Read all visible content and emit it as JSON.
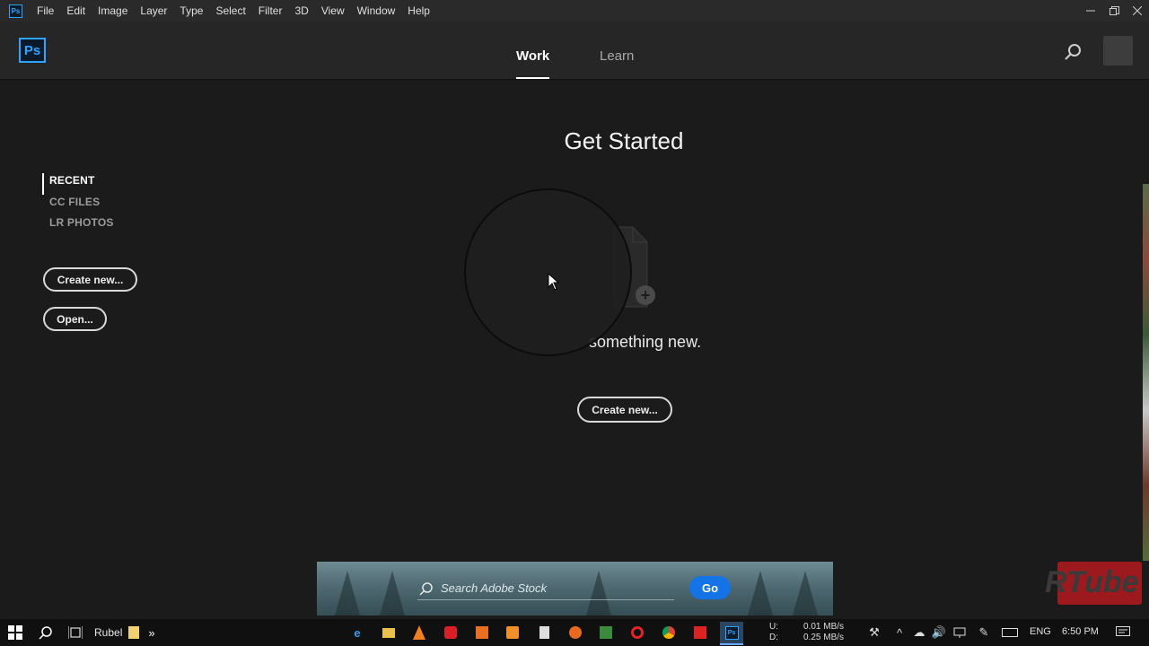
{
  "menubar": {
    "app_icon": "ps-mini-icon",
    "items": [
      "File",
      "Edit",
      "Image",
      "Layer",
      "Type",
      "Select",
      "Filter",
      "3D",
      "View",
      "Window",
      "Help"
    ],
    "controls": {
      "minimize": "minimize-icon",
      "restore": "restore-icon",
      "close": "close-icon"
    }
  },
  "header": {
    "logo": "Ps",
    "tabs": [
      {
        "label": "Work",
        "active": true
      },
      {
        "label": "Learn",
        "active": false
      }
    ]
  },
  "sidebar": {
    "items": [
      {
        "label": "RECENT",
        "active": true
      },
      {
        "label": "CC FILES",
        "active": false
      },
      {
        "label": "LR PHOTOS",
        "active": false
      }
    ],
    "create_label": "Create new...",
    "open_label": "Open..."
  },
  "main": {
    "title": "Get Started",
    "hint": "something new.",
    "create_label": "Create new..."
  },
  "stock": {
    "placeholder": "Search Adobe Stock",
    "go_label": "Go"
  },
  "watermark": {
    "text": "RTube"
  },
  "taskbar": {
    "user": "Rubel",
    "net_labels": {
      "up": "U:",
      "down": "D:"
    },
    "net_values": {
      "up": "0.01 MB/s",
      "down": "0.25 MB/s"
    },
    "lang": "ENG",
    "time": "6:50 PM"
  },
  "colors": {
    "accent": "#2fa3ff",
    "go_button": "#1473e6",
    "background": "#1b1b1b"
  }
}
